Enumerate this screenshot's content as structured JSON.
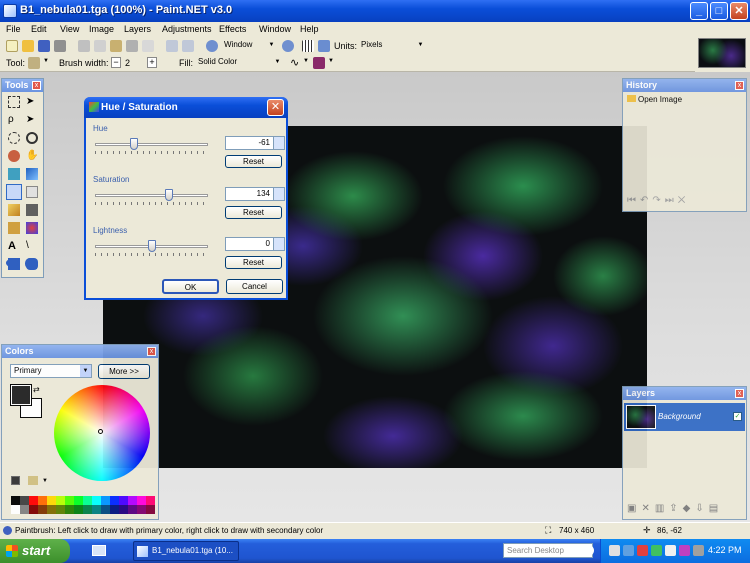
{
  "window": {
    "title": "B1_nebula01.tga (100%) - Paint.NET v3.0"
  },
  "menu": [
    "File",
    "Edit",
    "View",
    "Image",
    "Layers",
    "Adjustments",
    "Effects",
    "Window",
    "Help"
  ],
  "toolbar": {
    "zoom_value": "Window",
    "units_label": "Units:",
    "units_value": "Pixels"
  },
  "toolbar2": {
    "tool_label": "Tool:",
    "brush_label": "Brush width:",
    "brush_value": "2",
    "fill_label": "Fill:",
    "fill_value": "Solid Color"
  },
  "tools_panel": {
    "title": "Tools"
  },
  "history_panel": {
    "title": "History",
    "items": [
      "Open Image"
    ]
  },
  "colors_panel": {
    "title": "Colors",
    "mode": "Primary",
    "more_label": "More >>",
    "palette": [
      "#000000",
      "#404040",
      "#ff0000",
      "#ff6a00",
      "#ffd800",
      "#b6ff00",
      "#4cff00",
      "#00ff21",
      "#00ff90",
      "#00ffff",
      "#0094ff",
      "#0026ff",
      "#4800ff",
      "#b200ff",
      "#ff00dc",
      "#ff006e",
      "#ffffff",
      "#808080",
      "#7f0000",
      "#7f3300",
      "#7f6a00",
      "#5b7f00",
      "#267f00",
      "#007f0e",
      "#007f46",
      "#007f7f",
      "#004a7f",
      "#00137f",
      "#21007f",
      "#57007f",
      "#7f006e",
      "#7f0037"
    ]
  },
  "layers_panel": {
    "title": "Layers",
    "layer_name": "Background"
  },
  "dialog": {
    "title": "Hue / Saturation",
    "hue_label": "Hue",
    "hue_value": "-61",
    "saturation_label": "Saturation",
    "saturation_value": "134",
    "lightness_label": "Lightness",
    "lightness_value": "0",
    "reset_label": "Reset",
    "ok_label": "OK",
    "cancel_label": "Cancel",
    "hue_level": 0.33,
    "saturation_level": 0.67,
    "lightness_level": 0.5
  },
  "status": {
    "message": "Paintbrush: Left click to draw with primary color, right click to draw with secondary color",
    "image_size": "740 x 460",
    "cursor_pos": "86, -62"
  },
  "taskbar": {
    "start_label": "start",
    "task_label": "B1_nebula01.tga (10...",
    "search_placeholder": "Search Desktop",
    "clock": "4:22 PM"
  }
}
